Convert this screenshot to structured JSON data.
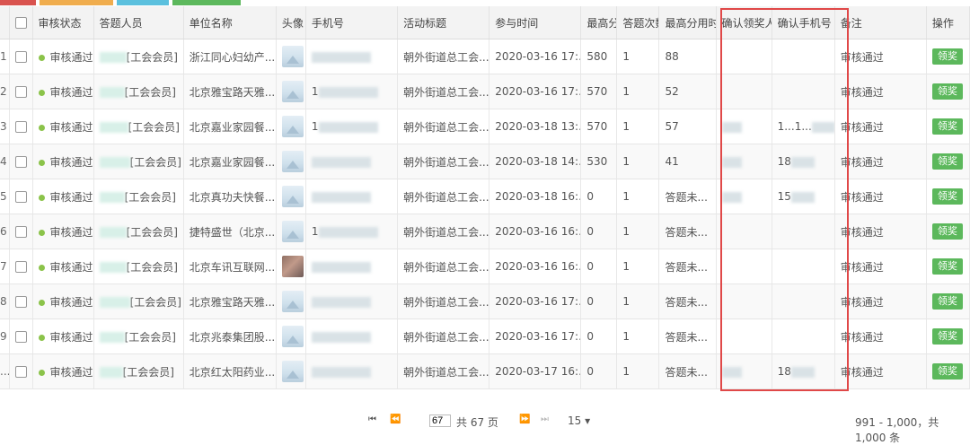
{
  "top_tabs": [
    {
      "color": "#d9534f"
    },
    {
      "color": "#f0ad4e"
    },
    {
      "color": "#5bc0de"
    },
    {
      "color": "#5cb85c"
    }
  ],
  "table": {
    "headers": {
      "status": "审核状态",
      "answerer": "答题人员",
      "company": "单位名称",
      "avatar": "头像",
      "phone": "手机号",
      "activity": "活动标题",
      "time": "参与时间",
      "max_score": "最高分",
      "attempts": "答题次数",
      "max_time": "最高分用时",
      "confirm_receiver": "确认领奖人",
      "confirm_phone": "确认手机号",
      "remark": "备注",
      "action": "操作"
    },
    "rows": [
      {
        "idx": "1",
        "status": "审核通过",
        "member": "[工会会员]",
        "company": "浙江同心妇幼产...",
        "avatar": "placeholder",
        "phone": "",
        "activity": "朝外街道总工会...",
        "time": "2020-03-16 17:...",
        "score": "580",
        "attempts": "1",
        "duration": "88",
        "receiver": "",
        "rphone": "",
        "remark": "审核通过",
        "action": "领奖"
      },
      {
        "idx": "2",
        "status": "审核通过",
        "member": "[工会会员]",
        "company": "北京雅宝路天雅...",
        "avatar": "placeholder",
        "phone": "1",
        "activity": "朝外街道总工会...",
        "time": "2020-03-16 17:...",
        "score": "570",
        "attempts": "1",
        "duration": "52",
        "receiver": "",
        "rphone": "",
        "remark": "审核通过",
        "action": "领奖"
      },
      {
        "idx": "3",
        "status": "审核通过",
        "member": "[工会会员]",
        "company": "北京嘉业家园餐...",
        "avatar": "placeholder",
        "phone": "1",
        "activity": "朝外街道总工会...",
        "time": "2020-03-18 13:...",
        "score": "570",
        "attempts": "1",
        "duration": "57",
        "receiver": "",
        "rphone": "1...1...",
        "remark": "审核通过",
        "action": "领奖"
      },
      {
        "idx": "4",
        "status": "审核通过",
        "member": "[工会会员]",
        "company": "北京嘉业家园餐...",
        "avatar": "placeholder",
        "phone": "",
        "activity": "朝外街道总工会...",
        "time": "2020-03-18 14:...",
        "score": "530",
        "attempts": "1",
        "duration": "41",
        "receiver": "",
        "rphone": "18",
        "remark": "审核通过",
        "action": "领奖"
      },
      {
        "idx": "5",
        "status": "审核通过",
        "member": "[工会会员]",
        "company": "北京真功夫快餐...",
        "avatar": "placeholder",
        "phone": "",
        "activity": "朝外街道总工会...",
        "time": "2020-03-18 16:...",
        "score": "0",
        "attempts": "1",
        "duration": "答题未...",
        "receiver": "",
        "rphone": "15",
        "remark": "审核通过",
        "action": "领奖"
      },
      {
        "idx": "6",
        "status": "审核通过",
        "member": "[工会会员]",
        "company": "捷特盛世（北京...",
        "avatar": "placeholder",
        "phone": "1",
        "activity": "朝外街道总工会...",
        "time": "2020-03-16 16:...",
        "score": "0",
        "attempts": "1",
        "duration": "答题未...",
        "receiver": "",
        "rphone": "",
        "remark": "审核通过",
        "action": "领奖"
      },
      {
        "idx": "7",
        "status": "审核通过",
        "member": "[工会会员]",
        "company": "北京车讯互联网...",
        "avatar": "photo",
        "phone": "",
        "activity": "朝外街道总工会...",
        "time": "2020-03-16 16:...",
        "score": "0",
        "attempts": "1",
        "duration": "答题未...",
        "receiver": "",
        "rphone": "",
        "remark": "审核通过",
        "action": "领奖"
      },
      {
        "idx": "8",
        "status": "审核通过",
        "member": "[工会会员]",
        "company": "北京雅宝路天雅...",
        "avatar": "placeholder",
        "phone": "",
        "activity": "朝外街道总工会...",
        "time": "2020-03-16 17:...",
        "score": "0",
        "attempts": "1",
        "duration": "答题未...",
        "receiver": "",
        "rphone": "",
        "remark": "审核通过",
        "action": "领奖"
      },
      {
        "idx": "9",
        "status": "审核通过",
        "member": "[工会会员]",
        "company": "北京兆泰集团股...",
        "avatar": "placeholder",
        "phone": "",
        "activity": "朝外街道总工会...",
        "time": "2020-03-16 17:...",
        "score": "0",
        "attempts": "1",
        "duration": "答题未...",
        "receiver": "",
        "rphone": "",
        "remark": "审核通过",
        "action": "领奖"
      },
      {
        "idx": "...",
        "status": "审核通过",
        "member": "[工会会员]",
        "company": "北京红太阳药业...",
        "avatar": "placeholder",
        "phone": "",
        "activity": "朝外街道总工会...",
        "time": "2020-03-17 16:...",
        "score": "0",
        "attempts": "1",
        "duration": "答题未...",
        "receiver": "",
        "rphone": "18",
        "remark": "审核通过",
        "action": "领奖"
      }
    ]
  },
  "pager": {
    "first": "⏮",
    "prev": "⏪",
    "page": "67",
    "total": "共 67 页",
    "next": "⏩",
    "last": "⏭",
    "page_size": "15 ▾",
    "summary": "991 - 1,000，共 1,000 条"
  }
}
